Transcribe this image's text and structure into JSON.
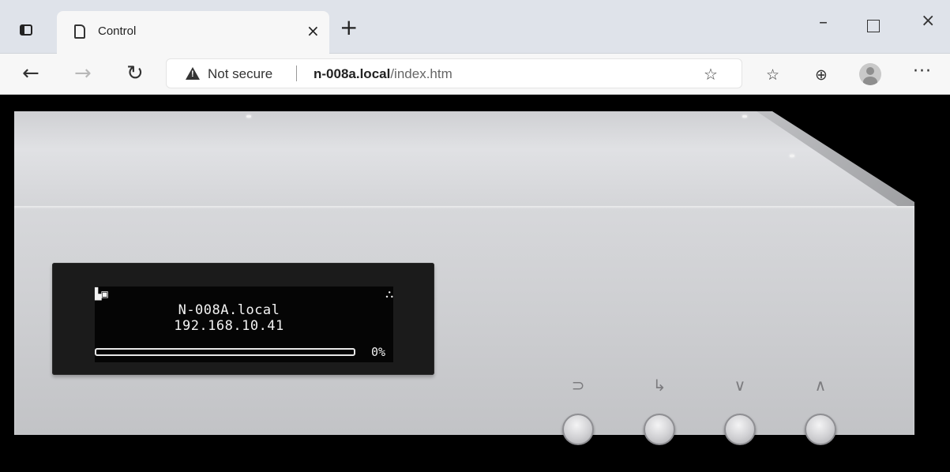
{
  "browser": {
    "tab": {
      "title": "Control",
      "close": "×"
    },
    "new_tab": "+",
    "window": {
      "minimize": "–",
      "close": "×"
    },
    "nav": {
      "back": "←",
      "forward": "→",
      "reload": "↻"
    },
    "address": {
      "security_label": "Not secure",
      "host": "n-008a.local",
      "path": "/index.htm"
    },
    "toolbar": {
      "favorites": "☆",
      "collections": "⊕",
      "more": "···"
    }
  },
  "device": {
    "display": {
      "icons_left": "▙▣",
      "icon_right": "⛬",
      "line1": "N-008A.local",
      "line2": "192.168.10.41",
      "progress_percent": 0,
      "progress_label": "0%"
    },
    "controls": [
      {
        "name": "back",
        "glyph": "⊃"
      },
      {
        "name": "enter",
        "glyph": "↳"
      },
      {
        "name": "down",
        "glyph": "∨"
      },
      {
        "name": "up",
        "glyph": "∧"
      }
    ]
  },
  "colors": {
    "device_silver": "#cfd0d3",
    "display_bg": "#050505",
    "display_text": "#f2f2f2"
  }
}
